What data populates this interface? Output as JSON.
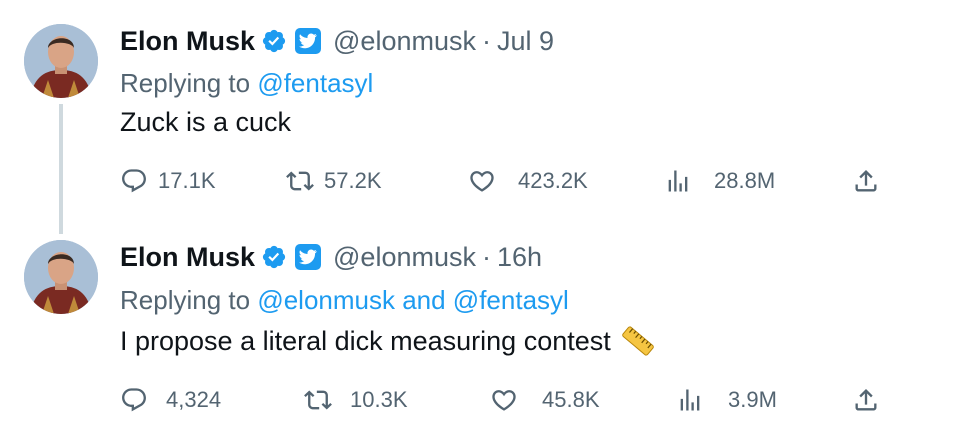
{
  "colors": {
    "accent": "#1d9bf0",
    "secondary_text": "#536471",
    "thread_line": "#cfd9de"
  },
  "tweets": [
    {
      "author_name": "Elon Musk",
      "handle": "@elonmusk",
      "separator": "·",
      "time": "Jul 9",
      "replying_prefix": "Replying to",
      "replying_mentions": "@fentasyl",
      "text": "Zuck is a cuck",
      "stats": {
        "replies": "17.1K",
        "retweets": "57.2K",
        "likes": "423.2K",
        "views": "28.8M"
      }
    },
    {
      "author_name": "Elon Musk",
      "handle": "@elonmusk",
      "separator": "·",
      "time": "16h",
      "replying_prefix": "Replying to",
      "replying_mentions": "@elonmusk and @fentasyl",
      "text": "I propose a literal dick measuring contest",
      "emoji": "straight-ruler-icon",
      "stats": {
        "replies": "4,324",
        "retweets": "10.3K",
        "likes": "45.8K",
        "views": "3.9M"
      }
    }
  ]
}
